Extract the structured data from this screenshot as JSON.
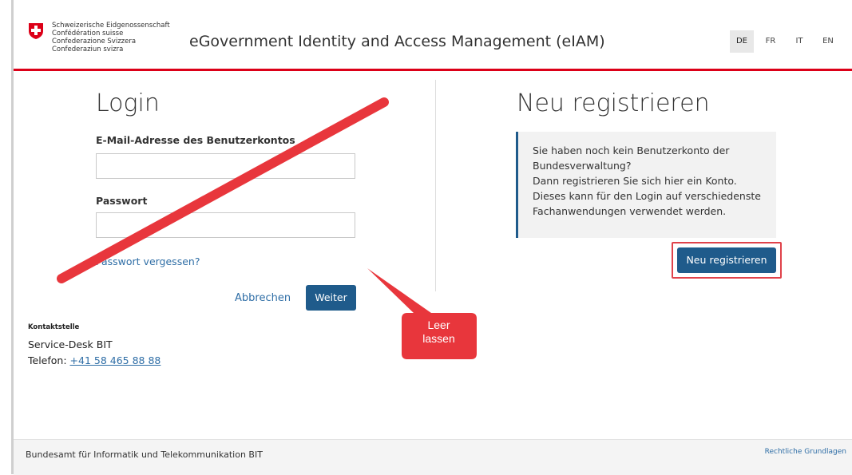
{
  "header": {
    "confederation": [
      "Schweizerische Eidgenossenschaft",
      "Confédération suisse",
      "Confederazione Svizzera",
      "Confederaziun svizra"
    ],
    "app_title": "eGovernment Identity and Access Management (eIAM)",
    "languages": [
      "DE",
      "FR",
      "IT",
      "EN"
    ],
    "active_language": "DE"
  },
  "login": {
    "title": "Login",
    "email_label": "E-Mail-Adresse des Benutzerkontos",
    "email_value": "",
    "password_label": "Passwort",
    "password_value": "",
    "forgot_link": "Passwort vergessen?",
    "cancel_label": "Abbrechen",
    "next_label": "Weiter"
  },
  "register": {
    "title": "Neu registrieren",
    "info_lines": [
      "Sie haben noch kein Benutzerkonto der",
      "Bundesverwaltung?",
      "Dann registrieren Sie sich hier ein Konto.",
      "Dieses kann für den Login auf verschiedenste",
      "Fachanwendungen verwendet werden."
    ],
    "button_label": "Neu registrieren"
  },
  "contact": {
    "heading": "Kontaktstelle",
    "service_desk": "Service-Desk BIT",
    "phone_label": "Telefon: ",
    "phone_number": "+41 58 465 88 88"
  },
  "footer": {
    "org": "Bundesamt für Informatik und Telekommunikation BIT",
    "legal_link": "Rechtliche Grundlagen"
  },
  "annotation": {
    "callout_line1": "Leer",
    "callout_line2": "lassen",
    "color": "#e8363c"
  },
  "colors": {
    "brand_red": "#dc0018",
    "primary_button": "#1f5b8b",
    "link": "#2f6ea6"
  }
}
